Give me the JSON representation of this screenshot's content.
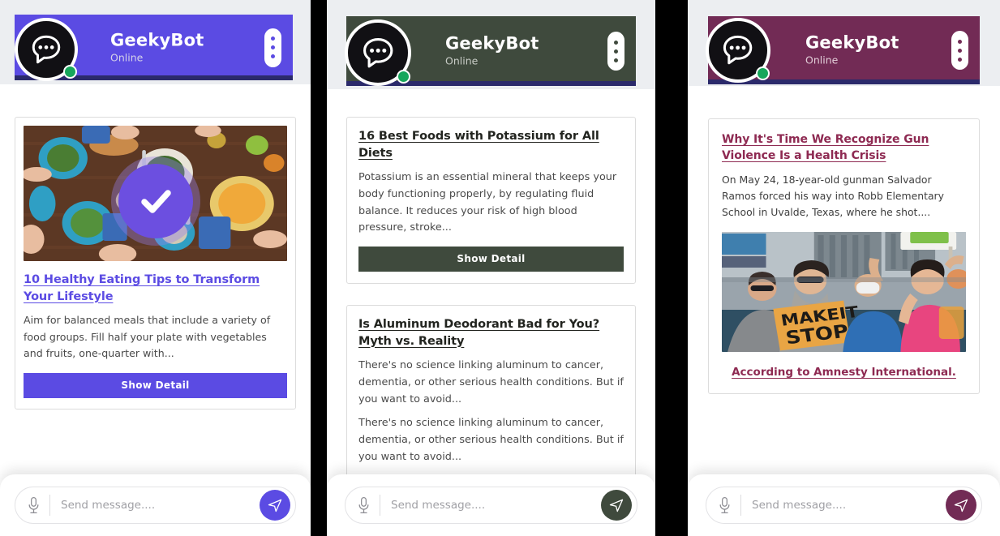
{
  "app": {
    "bot_name": "GeekyBot",
    "status": "Online",
    "menu_icon": "kebab-menu-icon",
    "avatar_icon": "chat-bubble-avatar-icon",
    "online_indicator": "online-status-dot"
  },
  "composer": {
    "placeholder": "Send message....",
    "value": "",
    "mic_icon": "microphone-icon",
    "send_icon": "send-paper-plane-icon"
  },
  "panels": [
    {
      "theme_color": "#5b4be3",
      "accent_underline": "#2b2a6b",
      "overlay_icon": "checkmark-confirmation-icon",
      "cards": [
        {
          "image": "overhead-photo-of-people-sharing-healthy-meal-at-wooden-table",
          "title": "10 Healthy Eating Tips to Transform Your Lifestyle",
          "body": "Aim for balanced meals that include a variety of food groups. Fill half your plate with vegetables and fruits, one-quarter with...",
          "button_label": "Show Detail"
        }
      ]
    },
    {
      "theme_color": "#3f4a3d",
      "accent_underline": "#2b2a6b",
      "cards": [
        {
          "title": "16 Best Foods with Potassium for All Diets",
          "body": "Potassium is an essential mineral that keeps your body functioning properly, by regulating fluid balance. It reduces your risk of high blood pressure, stroke...",
          "button_label": "Show Detail"
        },
        {
          "title": "Is Aluminum Deodorant Bad for You? Myth vs. Reality",
          "body": "There's no science linking aluminum to cancer, dementia, or other serious health conditions. But if you want to avoid...",
          "body2": "There's no science linking aluminum to cancer, dementia, or other serious health conditions. But if you want to avoid..."
        }
      ]
    },
    {
      "theme_color": "#722b55",
      "accent_underline": "#2b2a6b",
      "cards": [
        {
          "title": "Why It's Time We Recognize Gun Violence Is a Health Crisis",
          "body": "On May 24, 18-year-old gunman Salvador Ramos forced his way into Robb Elementary School in Uvalde, Texas, where he shot....",
          "image": "protest-crowd-photo-with-make-it-stop-sign",
          "source_link": "According to Amnesty International."
        }
      ]
    }
  ]
}
